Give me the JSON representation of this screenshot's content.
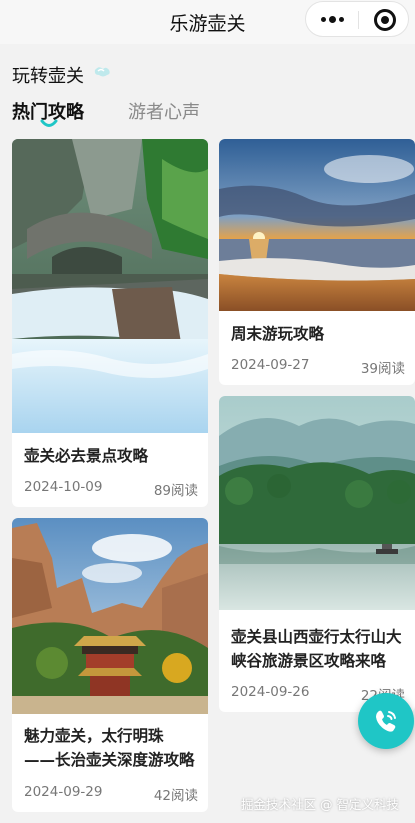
{
  "navbar": {
    "title": "乐游壶关",
    "more_icon": "more-dots-icon",
    "close_icon": "mini-program-close-icon"
  },
  "section": {
    "title": "玩转壶关"
  },
  "tabs": [
    {
      "label": "热门攻略",
      "active": true
    },
    {
      "label": "游者心声",
      "active": false
    }
  ],
  "cards": [
    {
      "title": "壶关必去景点攻略",
      "date": "2024-10-09",
      "reads": "89阅读"
    },
    {
      "title": "魅力壶关，太行明珠 ——长治壶关深度游攻略",
      "date": "2024-09-29",
      "reads": "42阅读"
    },
    {
      "title": "周末游玩攻略",
      "date": "2024-09-27",
      "reads": "39阅读"
    },
    {
      "title": "壶关县山西壶行太行山大峡谷旅游景区攻略来咯",
      "date": "2024-09-26",
      "reads": "22阅读"
    }
  ],
  "fab": {
    "icon": "phone-icon",
    "color": "#1fc6c6"
  },
  "watermark": {
    "text": "掘金技术社区 @ 智定义科技"
  },
  "colors": {
    "accent": "#1fc6c6",
    "background": "#f2f2f2"
  }
}
